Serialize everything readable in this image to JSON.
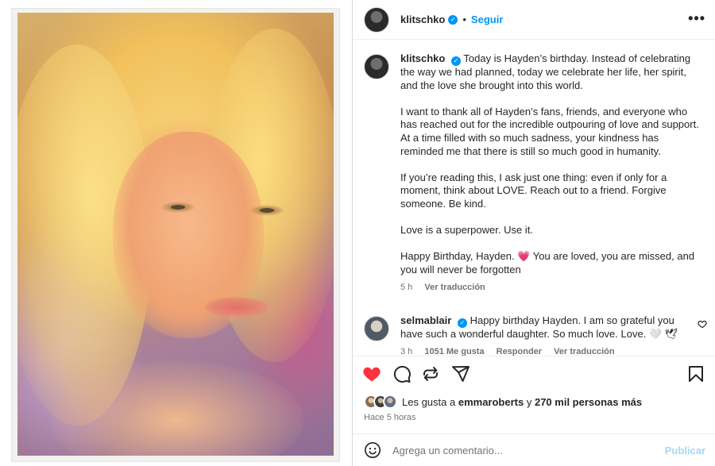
{
  "post": {
    "author": "klitschko",
    "follow_label": "Seguir",
    "more_label": "•••",
    "dot": "•",
    "verified_mark": "✓"
  },
  "caption": {
    "author": "klitschko",
    "paragraphs": [
      "Today is Hayden’s birthday. Instead of celebrating the way we had planned, today we celebrate her life, her spirit, and the love she brought into this world.",
      "I want to thank all of Hayden’s fans, friends, and everyone who has reached out for the incredible outpouring of love and support. At a time filled with so much sadness, your kindness has reminded me that there is still so much good in humanity.",
      "If you’re reading this, I ask just one thing: even if only for a moment, think about LOVE. Reach out to a friend. Forgive someone. Be kind.",
      "Love is a superpower. Use it.",
      "Happy Birthday, Hayden. 💗 You are loved, you are missed, and you will never be forgotten"
    ],
    "time": "5 h",
    "translate": "Ver traducción"
  },
  "comment": {
    "author": "selmablair",
    "text": "Happy birthday Hayden. I am so grateful you have such a wonderful daughter. So much love. Love. 🤍 🕊",
    "time": "3 h",
    "likes": "1051 Me gusta",
    "reply": "Responder",
    "translate": "Ver traducción"
  },
  "likes": {
    "prefix": "Les gusta a",
    "user": "emmaroberts",
    "conj": "y",
    "others": "270 mil personas más"
  },
  "timestamp": "Hace 5 horas",
  "composer": {
    "placeholder": "Agrega un comentario...",
    "publish": "Publicar"
  },
  "colors": {
    "accent": "#0095f6",
    "like_red": "#ff3040",
    "muted": "#737373",
    "publish_disabled": "#a7d6f9"
  },
  "icons": [
    "heart-icon",
    "comment-icon",
    "repost-icon",
    "share-icon",
    "bookmark-icon",
    "emoji-icon",
    "small-heart-icon"
  ]
}
